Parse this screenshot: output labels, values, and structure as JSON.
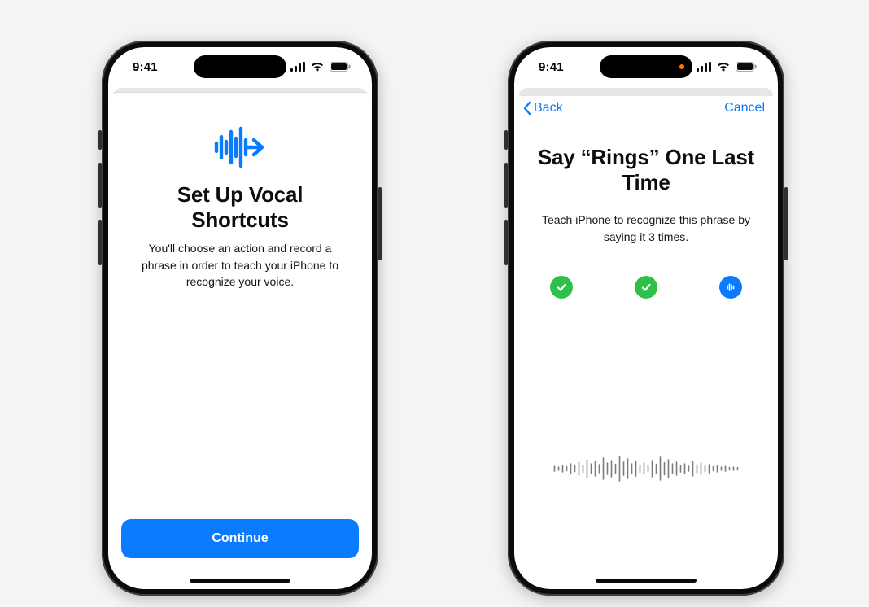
{
  "colors": {
    "accent": "#0a7bff",
    "success": "#2ec14a"
  },
  "status": {
    "time": "9:41"
  },
  "phones": {
    "left": {
      "intro": {
        "title": "Set Up Vocal Shortcuts",
        "description": "You'll choose an action and record a phrase in order to teach your iPhone to recognize your voice.",
        "continue_label": "Continue"
      }
    },
    "right": {
      "nav": {
        "back_label": "Back",
        "cancel_label": "Cancel"
      },
      "teach": {
        "title": "Say “Rings” One Last Time",
        "description": "Teach iPhone to recognize this phrase by saying it 3 times.",
        "recordings": [
          {
            "status": "done"
          },
          {
            "status": "done"
          },
          {
            "status": "active"
          }
        ]
      }
    }
  }
}
